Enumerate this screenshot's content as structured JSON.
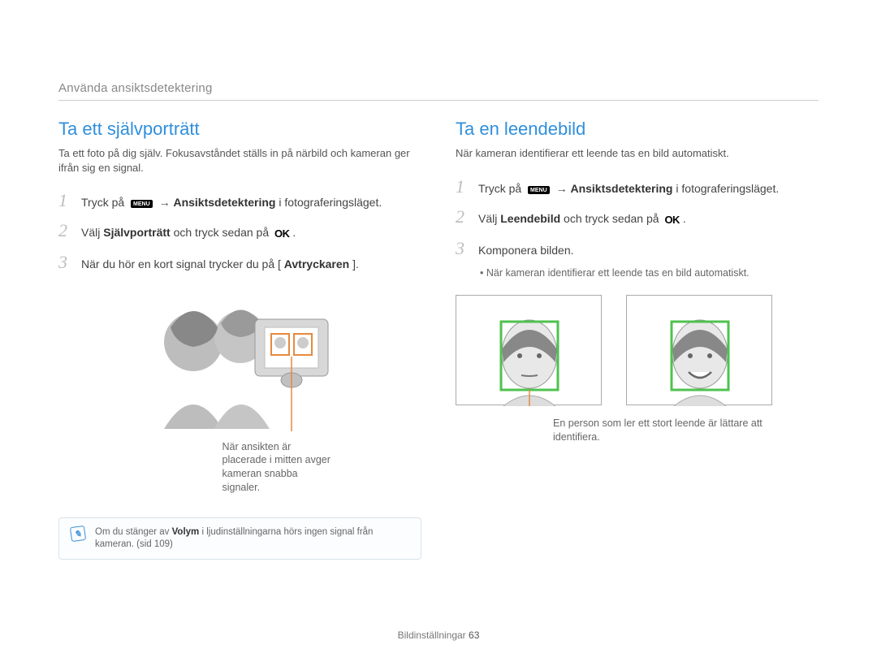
{
  "breadcrumb": "Använda ansiktsdetektering",
  "left": {
    "title": "Ta ett självporträtt",
    "intro": "Ta ett foto på dig själv. Fokusavståndet ställs in på närbild och kameran ger ifrån sig en signal.",
    "step1_pre": "Tryck på ",
    "menu_label": "MENU",
    "step1_arrow": " → ",
    "step1_bold": "Ansiktsdetektering",
    "step1_post": " i fotograferingsläget.",
    "step2_pre": "Välj ",
    "step2_bold": "Självporträtt",
    "step2_mid": " och tryck sedan på ",
    "ok_label": "OK",
    "step2_post": ".",
    "step3_pre": "När du hör en kort signal trycker du på [",
    "step3_bold": "Avtryckaren",
    "step3_post": "].",
    "illus_caption": "När ansikten är placerade i mitten avger kameran snabba signaler.",
    "note_pre": "Om du stänger av ",
    "note_bold": "Volym",
    "note_post": " i ljudinställningarna hörs ingen signal från kameran. (sid 109)"
  },
  "right": {
    "title": "Ta en leendebild",
    "intro": "När kameran identifierar ett leende tas en bild automatiskt.",
    "step1_pre": "Tryck på ",
    "menu_label": "MENU",
    "step1_arrow": " → ",
    "step1_bold": "Ansiktsdetektering",
    "step1_post": " i fotograferingsläget.",
    "step2_pre": "Välj ",
    "step2_bold": "Leendebild",
    "step2_mid": " och tryck sedan på ",
    "ok_label": "OK",
    "step2_post": ".",
    "step3": "Komponera bilden.",
    "sub_bullet": "När kameran identifierar ett leende tas en bild automatiskt.",
    "face_caption": "En person som ler ett stort leende är lättare att identifiera."
  },
  "footer_label": "Bildinställningar ",
  "footer_page": "63"
}
